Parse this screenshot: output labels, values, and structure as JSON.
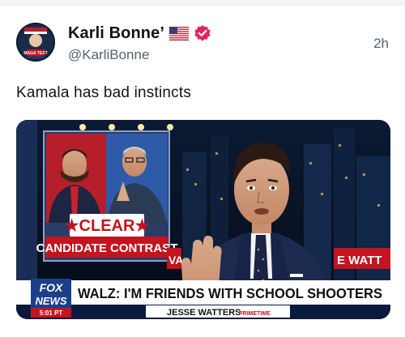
{
  "post": {
    "display_name": "Karli Bonne’",
    "handle": "@KarliBonne",
    "timestamp": "2h",
    "text": "Kamala has bad instincts",
    "flag_icon": "us-flag-icon",
    "verified_icon": "verified-badge-icon",
    "verified_color": "#e0245e"
  },
  "media": {
    "screen_label_top": "★CLEAR★",
    "screen_label_bottom": "CANDIDATE CONTRAST",
    "side_banner": "E WATT",
    "side_banner_left": "VA",
    "chyron_headline": "WALZ: I'M FRIENDS WITH SCHOOL SHOOTERS",
    "show_name": "JESSE WATTERS",
    "show_tag": "PRIMETIME",
    "network_line1": "FOX",
    "network_line2": "NEWS",
    "network_time": "5:01 PT"
  },
  "avatar": {
    "badge_text": "MAGA TEXT"
  }
}
